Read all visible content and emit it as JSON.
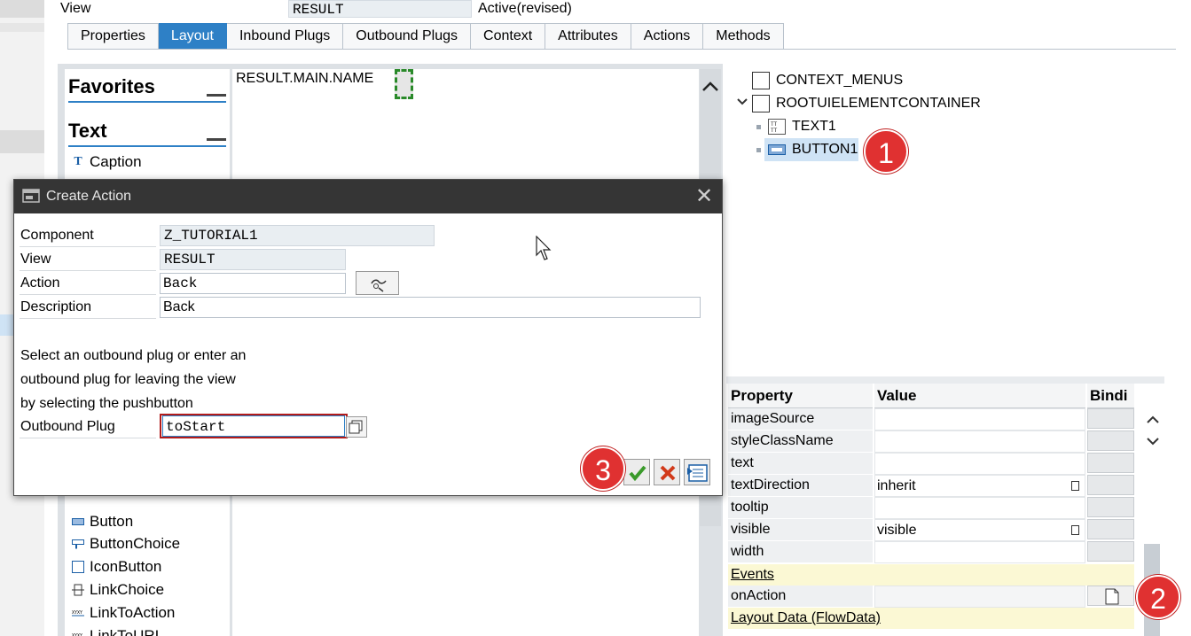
{
  "header": {
    "view_label": "View",
    "view_value": "RESULT",
    "status": "Active(revised)"
  },
  "tabs": [
    {
      "label": "Properties",
      "active": false
    },
    {
      "label": "Layout",
      "active": true
    },
    {
      "label": "Inbound Plugs",
      "active": false
    },
    {
      "label": "Outbound Plugs",
      "active": false
    },
    {
      "label": "Context",
      "active": false
    },
    {
      "label": "Attributes",
      "active": false
    },
    {
      "label": "Actions",
      "active": false
    },
    {
      "label": "Methods",
      "active": false
    }
  ],
  "palette": {
    "favorites_title": "Favorites",
    "text_title": "Text",
    "text_items": [
      "Caption"
    ],
    "action_items": [
      "Button",
      "ButtonChoice",
      "IconButton",
      "LinkChoice",
      "LinkToAction",
      "LinkToURL"
    ]
  },
  "canvas": {
    "text": "RESULT.MAIN.NAME"
  },
  "hierarchy": {
    "nodes": [
      {
        "label": "CONTEXT_MENUS"
      },
      {
        "label": "ROOTUIELEMENTCONTAINER"
      },
      {
        "label": "TEXT1"
      },
      {
        "label": "BUTTON1"
      }
    ]
  },
  "properties": {
    "headers": {
      "property": "Property",
      "value": "Value",
      "binding": "Bindi"
    },
    "rows": [
      {
        "name": "imageSource",
        "value": ""
      },
      {
        "name": "styleClassName",
        "value": ""
      },
      {
        "name": "text",
        "value": ""
      },
      {
        "name": "textDirection",
        "value": "inherit"
      },
      {
        "name": "tooltip",
        "value": ""
      },
      {
        "name": "visible",
        "value": "visible"
      },
      {
        "name": "width",
        "value": ""
      }
    ],
    "events_section": "Events",
    "event_rows": [
      {
        "name": "onAction",
        "value": ""
      }
    ],
    "layout_section": "Layout Data (FlowData)"
  },
  "dialog": {
    "title": "Create Action",
    "fields": {
      "component_label": "Component",
      "component_value": "Z_TUTORIAL1",
      "view_label": "View",
      "view_value": "RESULT",
      "action_label": "Action",
      "action_value": "Back",
      "description_label": "Description",
      "description_value": "Back"
    },
    "info_lines": [
      "Select an outbound plug or enter an",
      "outbound plug for leaving the view",
      "by selecting the pushbutton"
    ],
    "outbound_label": "Outbound Plug",
    "outbound_value": "toStart"
  },
  "markers": [
    "1",
    "2",
    "3"
  ],
  "icons": {
    "dialog_title": "window-icon",
    "close": "close-icon",
    "confirm": "checkmark-icon",
    "cancel": "cancel-icon",
    "details": "details-icon"
  }
}
